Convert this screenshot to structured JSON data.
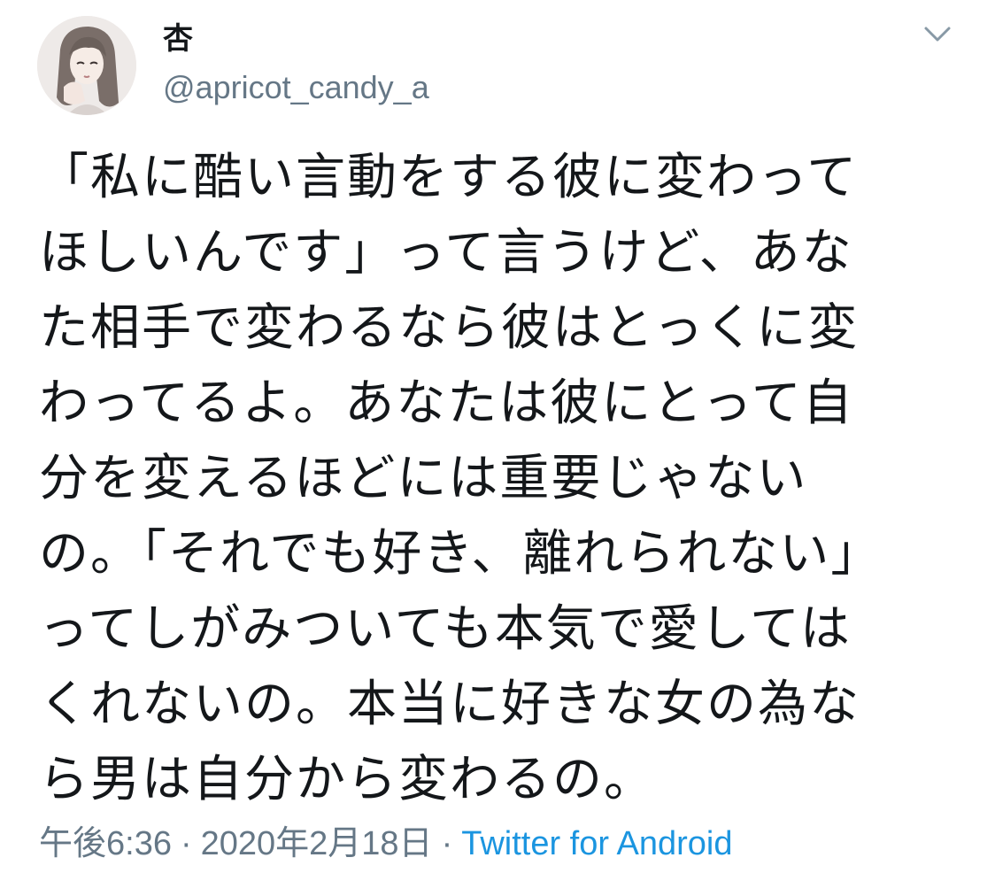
{
  "user": {
    "display_name": "杏",
    "handle": "@apricot_candy_a"
  },
  "tweet": {
    "lines": [
      "「私に酷い言動をする彼に変わって",
      "ほしいんです」って言うけど、あな",
      "た相手で変わるなら彼はとっくに変",
      "わってるよ。あなたは彼にとって自",
      "分を変えるほどには重要じゃない",
      "の。「それでも好き、離れられない」",
      "ってしがみついても本気で愛しては",
      "くれないの。本当に好きな女の為な",
      "ら男は自分から変わるの。"
    ],
    "time": "午後6:36",
    "date": "2020年2月18日",
    "separator": "·",
    "source": "Twitter for Android"
  },
  "colors": {
    "text": "#14171a",
    "secondary": "#657786",
    "link": "#1b95e0"
  },
  "icons": {
    "menu": "chevron-down-icon"
  }
}
